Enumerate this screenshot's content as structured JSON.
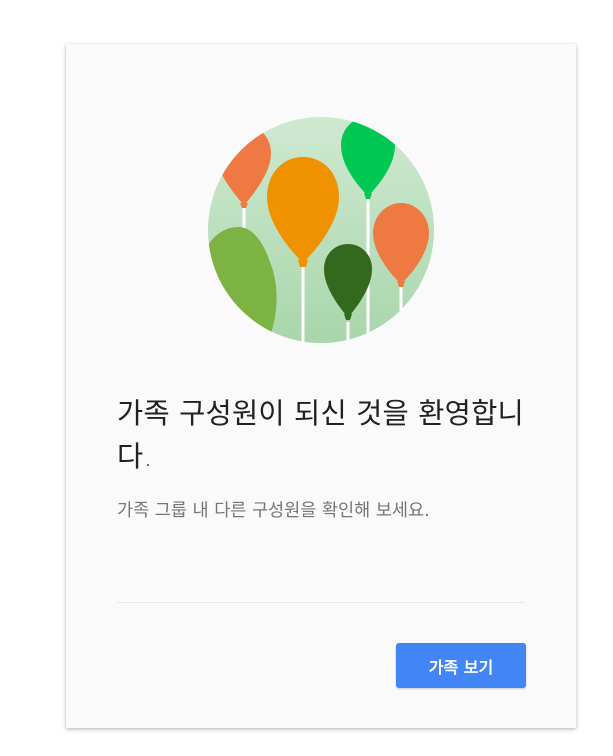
{
  "dialog": {
    "title": "가족 구성원이 되신 것을 환영합니다.",
    "subtitle": "가족 그룹 내 다른 구성원을 확인해 보세요.",
    "primary_button_label": "가족 보기"
  },
  "illustration": {
    "icon": "balloons-illustration-icon",
    "circle_color": "#c8e6c9",
    "balloon_colors": [
      "#ef7943",
      "#f09100",
      "#00c853",
      "#ef7943",
      "#7cb342",
      "#33691e"
    ]
  },
  "colors": {
    "accent": "#4285f4",
    "title_text": "#212121",
    "subtitle_text": "#757575",
    "card_background": "#fafafa"
  }
}
